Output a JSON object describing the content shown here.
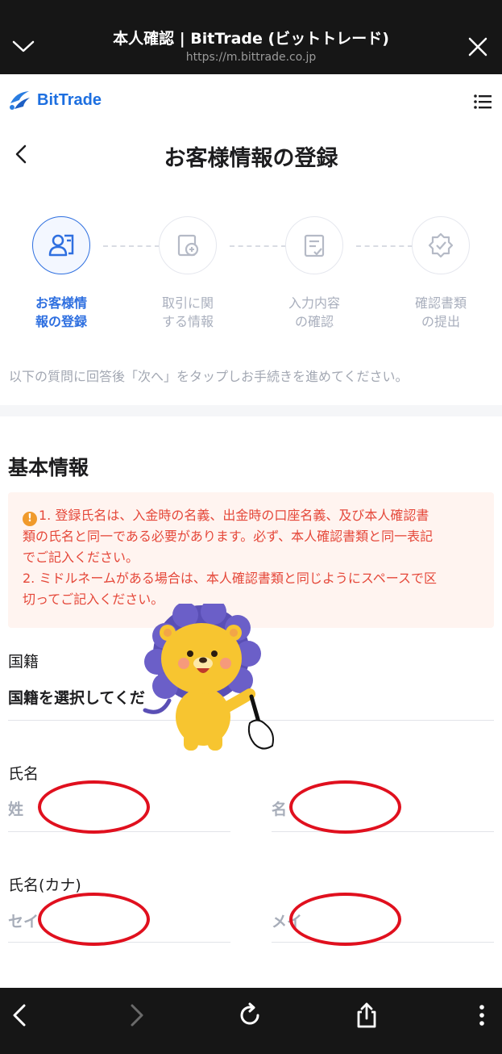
{
  "browser": {
    "title": "本人確認 | BitTrade (ビットトレード)",
    "url": "https://m.bittrade.co.jp"
  },
  "site": {
    "logo_text": "BitTrade",
    "brand_color": "#1d6fe0"
  },
  "page": {
    "title": "お客様情報の登録"
  },
  "steps": [
    {
      "label_line1": "お客様情",
      "label_line2": "報の登録",
      "icon": "user-id-icon",
      "active": true
    },
    {
      "label_line1": "取引に関",
      "label_line2": "する情報",
      "icon": "coin-document-icon",
      "active": false
    },
    {
      "label_line1": "入力内容",
      "label_line2": "の確認",
      "icon": "checklist-icon",
      "active": false
    },
    {
      "label_line1": "確認書類",
      "label_line2": "の提出",
      "icon": "badge-check-icon",
      "active": false
    }
  ],
  "instruction": "以下の質問に回答後「次へ」をタップしお手続きを進めてください。",
  "section": {
    "title": "基本情報"
  },
  "notice": {
    "line1": "1. 登録氏名は、入金時の名義、出金時の口座名義、及び本人確認書",
    "line2": "類の氏名と同一である必要があります。必ず、本人確認書類と同一表記",
    "line3": "でご記入ください。",
    "line4": "2. ミドルネームがある場合は、本人確認書類と同じようにスペースで区",
    "line5": "切ってご記入ください。"
  },
  "form": {
    "nationality_label": "国籍",
    "nationality_value": "国籍を選択してくだ",
    "name_label": "氏名",
    "last_name_placeholder": "姓",
    "first_name_placeholder": "名",
    "kana_label": "氏名(カナ)",
    "last_kana_placeholder": "セイ",
    "first_kana_placeholder": "メイ"
  },
  "colors": {
    "accent": "#2e6fe0",
    "warning_text": "#e5483a",
    "highlight_oval": "#e0101e"
  }
}
